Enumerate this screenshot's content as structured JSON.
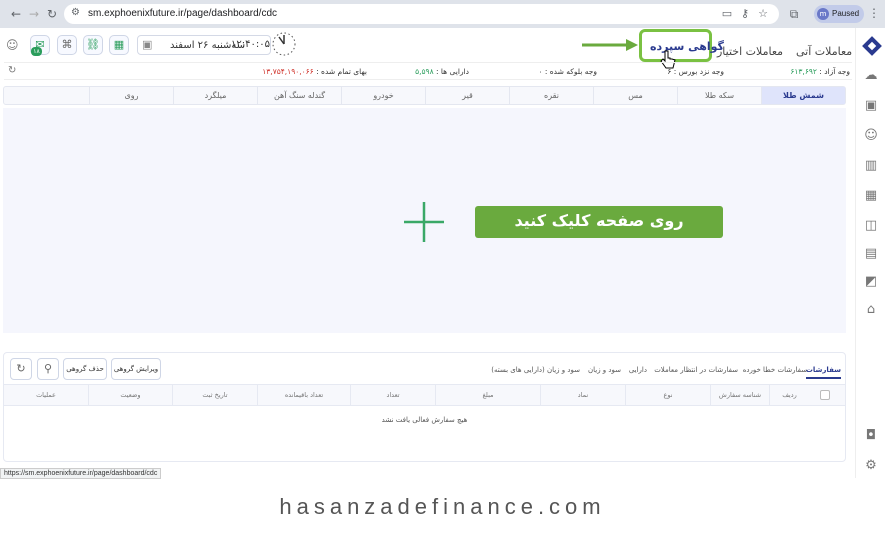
{
  "browser": {
    "url": "sm.exphoenixfuture.ir/page/dashboard/cdc",
    "profile_initial": "m",
    "profile_label": "Paused",
    "status_url": "https://sm.exphoenixfuture.ir/page/dashboard/cdc"
  },
  "header": {
    "tab_futures": "معاملات آتی",
    "tab_options": "معاملات اختیار",
    "tab_deposit": "گواهی سپرده",
    "date": "سه‌شنبه ۲۶ اسفند",
    "time": "۱۲:۴۰:۰۵",
    "badge_count": "۱۸"
  },
  "info": {
    "free_cash_label": "وجه آزاد :",
    "free_cash_value": "۶۱۳,۶۹۲",
    "broker_cash_label": "وجه نزد بورس :",
    "broker_cash_value": "۶",
    "blocked_label": "وجه بلوکه شده :",
    "blocked_value": "۰",
    "assets_label": "دارایی ها :",
    "assets_value": "۵,۵۹۸",
    "cost_label": "بهای تمام شده :",
    "cost_value": "۱۳,۷۵۴,۱۹۰,۰۶۶"
  },
  "commodities": [
    "شمش طلا",
    "سکه طلا",
    "مس",
    "نقره",
    "قیر",
    "خودرو",
    "گندله سنگ آهن",
    "میلگرد",
    "روی"
  ],
  "callout": "روی صفحه کلیک کنید",
  "orders": {
    "tabs": [
      "سفارشات",
      "سفارشات خطا خورده",
      "سفارشات در انتظار",
      "معاملات",
      "دارایی",
      "سود و زیان",
      "سود و زیان (دارایی های بسته)"
    ],
    "btn_group_edit": "ویرایش گروهی",
    "btn_group_delete": "حذف گروهی",
    "columns": [
      "ردیف",
      "شناسه سفارش",
      "نوع",
      "نماد",
      "مبلغ",
      "تعداد",
      "تعداد باقیمانده",
      "تاریخ ثبت",
      "وضعیت",
      "عملیات"
    ],
    "empty": "هیچ سفارش فعالی یافت نشد"
  },
  "watermark": "hasanzadefinance.com",
  "colors": {
    "brand": "#2a3a8f",
    "accent_green": "#6aaa3e",
    "danger": "#d0342c"
  }
}
